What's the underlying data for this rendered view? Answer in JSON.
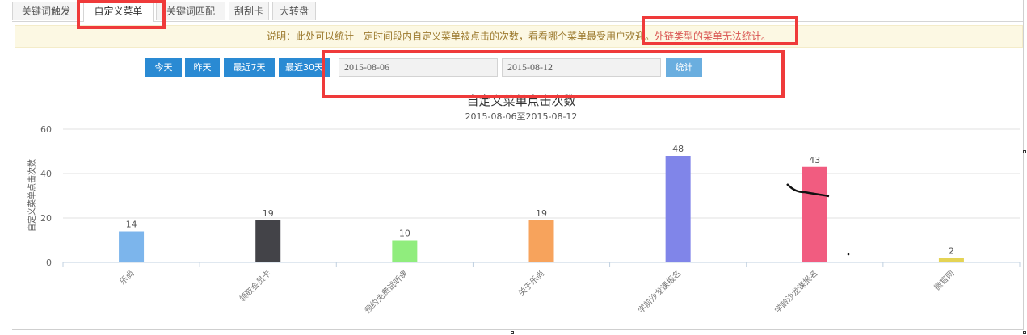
{
  "tabs": [
    {
      "label": "关键词触发",
      "active": false
    },
    {
      "label": "自定义菜单",
      "active": true
    },
    {
      "label": "关键词匹配",
      "active": false
    },
    {
      "label": "刮刮卡",
      "active": false
    },
    {
      "label": "大转盘",
      "active": false
    }
  ],
  "notice": {
    "text": "说明：此处可以统计一定时间段内自定义菜单被点击的次数，看看哪个菜单最受用户欢迎。",
    "warning": "外链类型的菜单无法统计。"
  },
  "filters": {
    "quick_buttons": [
      "今天",
      "昨天",
      "最近7天",
      "最近30天"
    ],
    "start_date": "2015-08-06",
    "end_date": "2015-08-12",
    "submit_label": "统计"
  },
  "colors": {
    "accent": "#2a8ad3",
    "annotation": "#ef3a3a"
  },
  "chart_data": {
    "type": "bar",
    "title": "自定义菜单点击次数",
    "subtitle": "2015-08-06至2015-08-12",
    "ylabel": "自定义菜单点击次数",
    "ylim": [
      0,
      60
    ],
    "yticks": [
      0,
      20,
      40,
      60
    ],
    "categories": [
      "乐尚",
      "领取会员卡",
      "预约免费试听课",
      "关于乐尚",
      "学前沙龙课报名",
      "学龄沙龙课报名",
      "微官网"
    ],
    "values": [
      14,
      19,
      10,
      19,
      48,
      43,
      2
    ],
    "bar_colors": [
      "#7cb5ec",
      "#434348",
      "#90ed7d",
      "#f7a35c",
      "#8085e9",
      "#f15c80",
      "#e4d354"
    ],
    "grid": true,
    "legend": "none"
  }
}
